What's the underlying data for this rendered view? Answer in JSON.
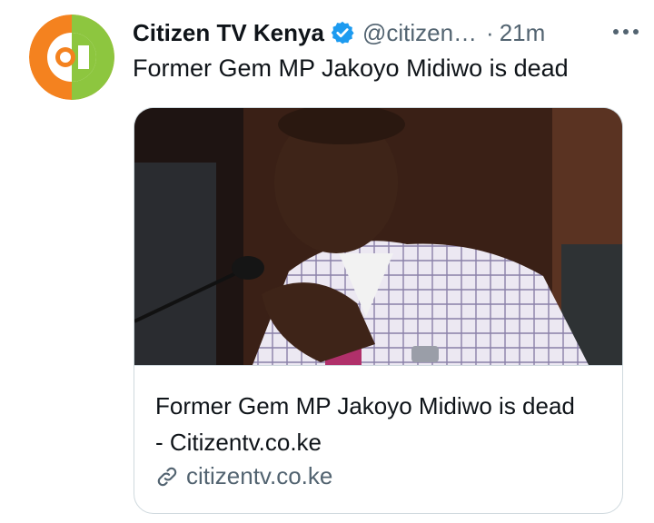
{
  "tweet": {
    "author_name": "Citizen TV Kenya",
    "handle": "@citizen…",
    "separator": "·",
    "time": "21m",
    "text": "Former Gem MP Jakoyo Midiwo is dead"
  },
  "card": {
    "title": "Former Gem MP Jakoyo Midiwo is dead - Citizentv.co.ke",
    "domain": "citizentv.co.ke"
  },
  "icons": {
    "verified": "verified-badge-icon",
    "more": "more-options-icon",
    "link": "link-icon"
  },
  "colors": {
    "accent_blue": "#1d9bf0",
    "secondary_text": "#536471",
    "border": "#cfd9de",
    "logo_orange": "#f4821f",
    "logo_green": "#8dc63f"
  }
}
